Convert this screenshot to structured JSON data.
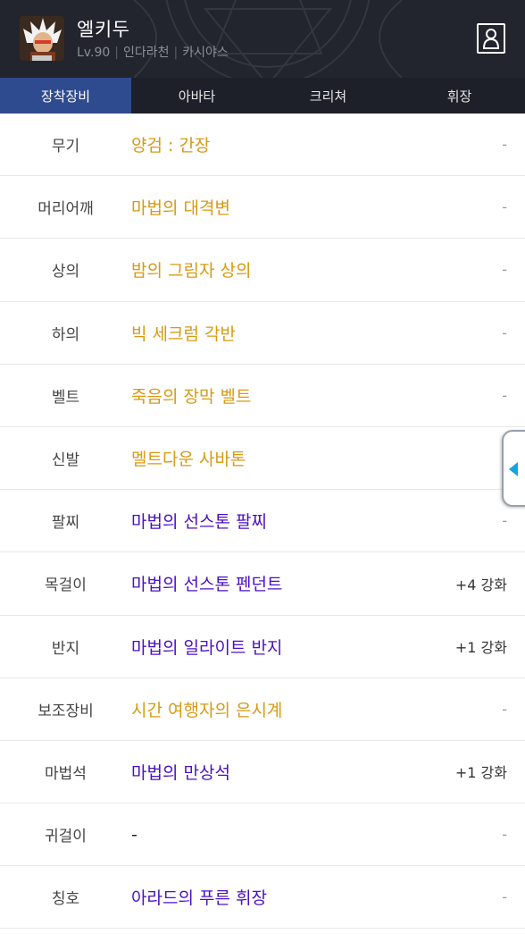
{
  "profile": {
    "name": "엘키두",
    "level": "Lv.90",
    "job": "인다라천",
    "server": "카시야스",
    "separator": "|"
  },
  "tabs": [
    {
      "label": "장착장비",
      "active": true
    },
    {
      "label": "아바타",
      "active": false
    },
    {
      "label": "크리쳐",
      "active": false
    },
    {
      "label": "휘장",
      "active": false
    }
  ],
  "colors": {
    "epic": "#d79a12",
    "unique": "#4a10c4",
    "active_tab": "#2f4b8f",
    "header_bg": "#22242e",
    "handle_arrow": "#14a4e0"
  },
  "equipment": [
    {
      "slot": "무기",
      "item": "양검 : 간장",
      "grade": "epic",
      "enhance": "-"
    },
    {
      "slot": "머리어깨",
      "item": "마법의 대격변",
      "grade": "epic",
      "enhance": "-"
    },
    {
      "slot": "상의",
      "item": "밤의 그림자 상의",
      "grade": "epic",
      "enhance": "-"
    },
    {
      "slot": "하의",
      "item": "빅 세크럼 각반",
      "grade": "epic",
      "enhance": "-"
    },
    {
      "slot": "벨트",
      "item": "죽음의 장막 벨트",
      "grade": "epic",
      "enhance": "-"
    },
    {
      "slot": "신발",
      "item": "멜트다운 사바톤",
      "grade": "epic",
      "enhance": "-"
    },
    {
      "slot": "팔찌",
      "item": "마법의 선스톤 팔찌",
      "grade": "unique",
      "enhance": "-"
    },
    {
      "slot": "목걸이",
      "item": "마법의 선스톤 펜던트",
      "grade": "unique",
      "enhance": "+4 강화"
    },
    {
      "slot": "반지",
      "item": "마법의 일라이트 반지",
      "grade": "unique",
      "enhance": "+1 강화"
    },
    {
      "slot": "보조장비",
      "item": "시간 여행자의 은시계",
      "grade": "epic",
      "enhance": "-"
    },
    {
      "slot": "마법석",
      "item": "마법의 만상석",
      "grade": "unique",
      "enhance": "+1 강화"
    },
    {
      "slot": "귀걸이",
      "item": "-",
      "grade": "none",
      "enhance": "-"
    },
    {
      "slot": "칭호",
      "item": "아라드의 푸른 휘장",
      "grade": "unique",
      "enhance": "-"
    }
  ],
  "icons": {
    "avatar": "character-portrait-icon",
    "profile": "profile-card-icon",
    "side_handle": "left-arrow-icon"
  }
}
